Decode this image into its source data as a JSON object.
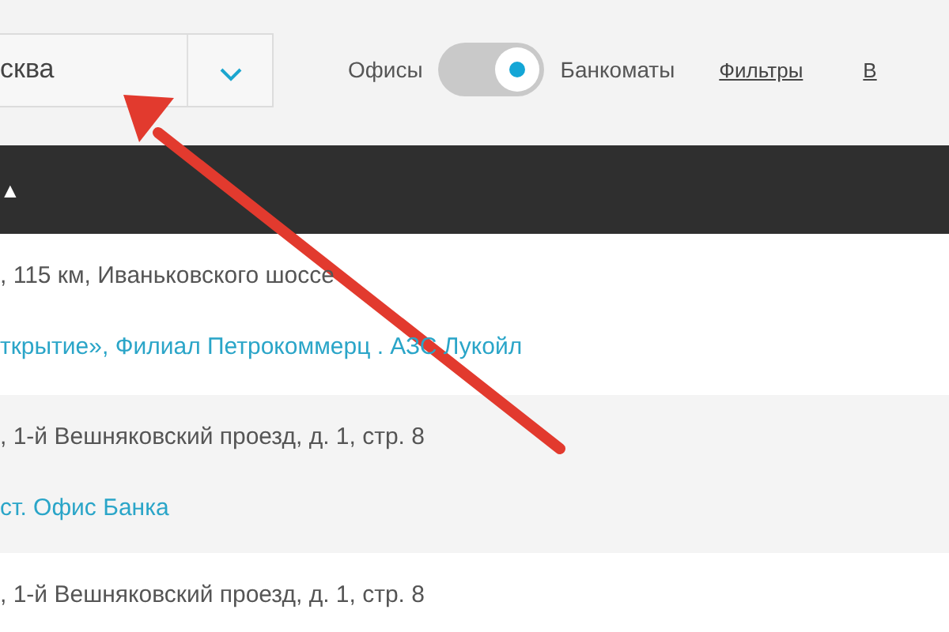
{
  "city_select": {
    "value": "сква"
  },
  "view_toggle": {
    "left_label": "Офисы",
    "right_label": "Банкоматы",
    "on": true
  },
  "links": [
    "Фильтры",
    "В"
  ],
  "table_header": {
    "sort_indicator": "▲"
  },
  "rows": [
    {
      "address": ", 115 км, Иваньковского шоссе",
      "name": "ткрытие», Филиал Петрокоммерц . АЗС Лукойл"
    },
    {
      "address": ", 1-й Вешняковский проезд, д. 1, стр. 8",
      "name": "ст. Офис Банка"
    },
    {
      "address": ", 1-й Вешняковский проезд, д. 1, стр. 8"
    }
  ]
}
